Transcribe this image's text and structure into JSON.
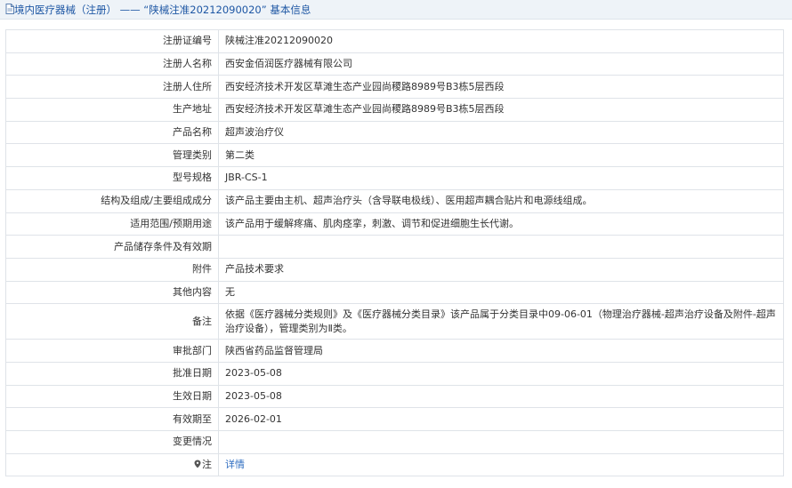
{
  "header": {
    "title": "境内医疗器械（注册） —— “陕械注准20212090020” 基本信息"
  },
  "rows": [
    {
      "label": "注册证编号",
      "value": "陕械注准20212090020"
    },
    {
      "label": "注册人名称",
      "value": "西安金佰润医疗器械有限公司"
    },
    {
      "label": "注册人住所",
      "value": "西安经济技术开发区草滩生态产业园尚稷路8989号B3栋5层西段"
    },
    {
      "label": "生产地址",
      "value": "西安经济技术开发区草滩生态产业园尚稷路8989号B3栋5层西段"
    },
    {
      "label": "产品名称",
      "value": "超声波治疗仪"
    },
    {
      "label": "管理类别",
      "value": "第二类"
    },
    {
      "label": "型号规格",
      "value": "JBR-CS-1"
    },
    {
      "label": "结构及组成/主要组成成分",
      "value": "该产品主要由主机、超声治疗头（含导联电极线）、医用超声耦合贴片和电源线组成。"
    },
    {
      "label": "适用范围/预期用途",
      "value": "该产品用于缓解疼痛、肌肉痉挛，刺激、调节和促进细胞生长代谢。"
    },
    {
      "label": "产品储存条件及有效期",
      "value": ""
    },
    {
      "label": "附件",
      "value": "产品技术要求"
    },
    {
      "label": "其他内容",
      "value": "无"
    },
    {
      "label": "备注",
      "value": "依据《医疗器械分类规则》及《医疗器械分类目录》该产品属于分类目录中09-06-01（物理治疗器械-超声治疗设备及附件-超声治疗设备），管理类别为Ⅱ类。"
    },
    {
      "label": "审批部门",
      "value": "陕西省药品监督管理局"
    },
    {
      "label": "批准日期",
      "value": "2023-05-08"
    },
    {
      "label": "生效日期",
      "value": "2023-05-08"
    },
    {
      "label": "有效期至",
      "value": "2026-02-01"
    },
    {
      "label": "变更情况",
      "value": ""
    }
  ],
  "note_row": {
    "label": "注",
    "link": "详情"
  },
  "colors": {
    "header_bg": "#eef3f8",
    "title": "#1e57a4",
    "link": "#2d6cc0",
    "border": "#dfe3e8"
  }
}
